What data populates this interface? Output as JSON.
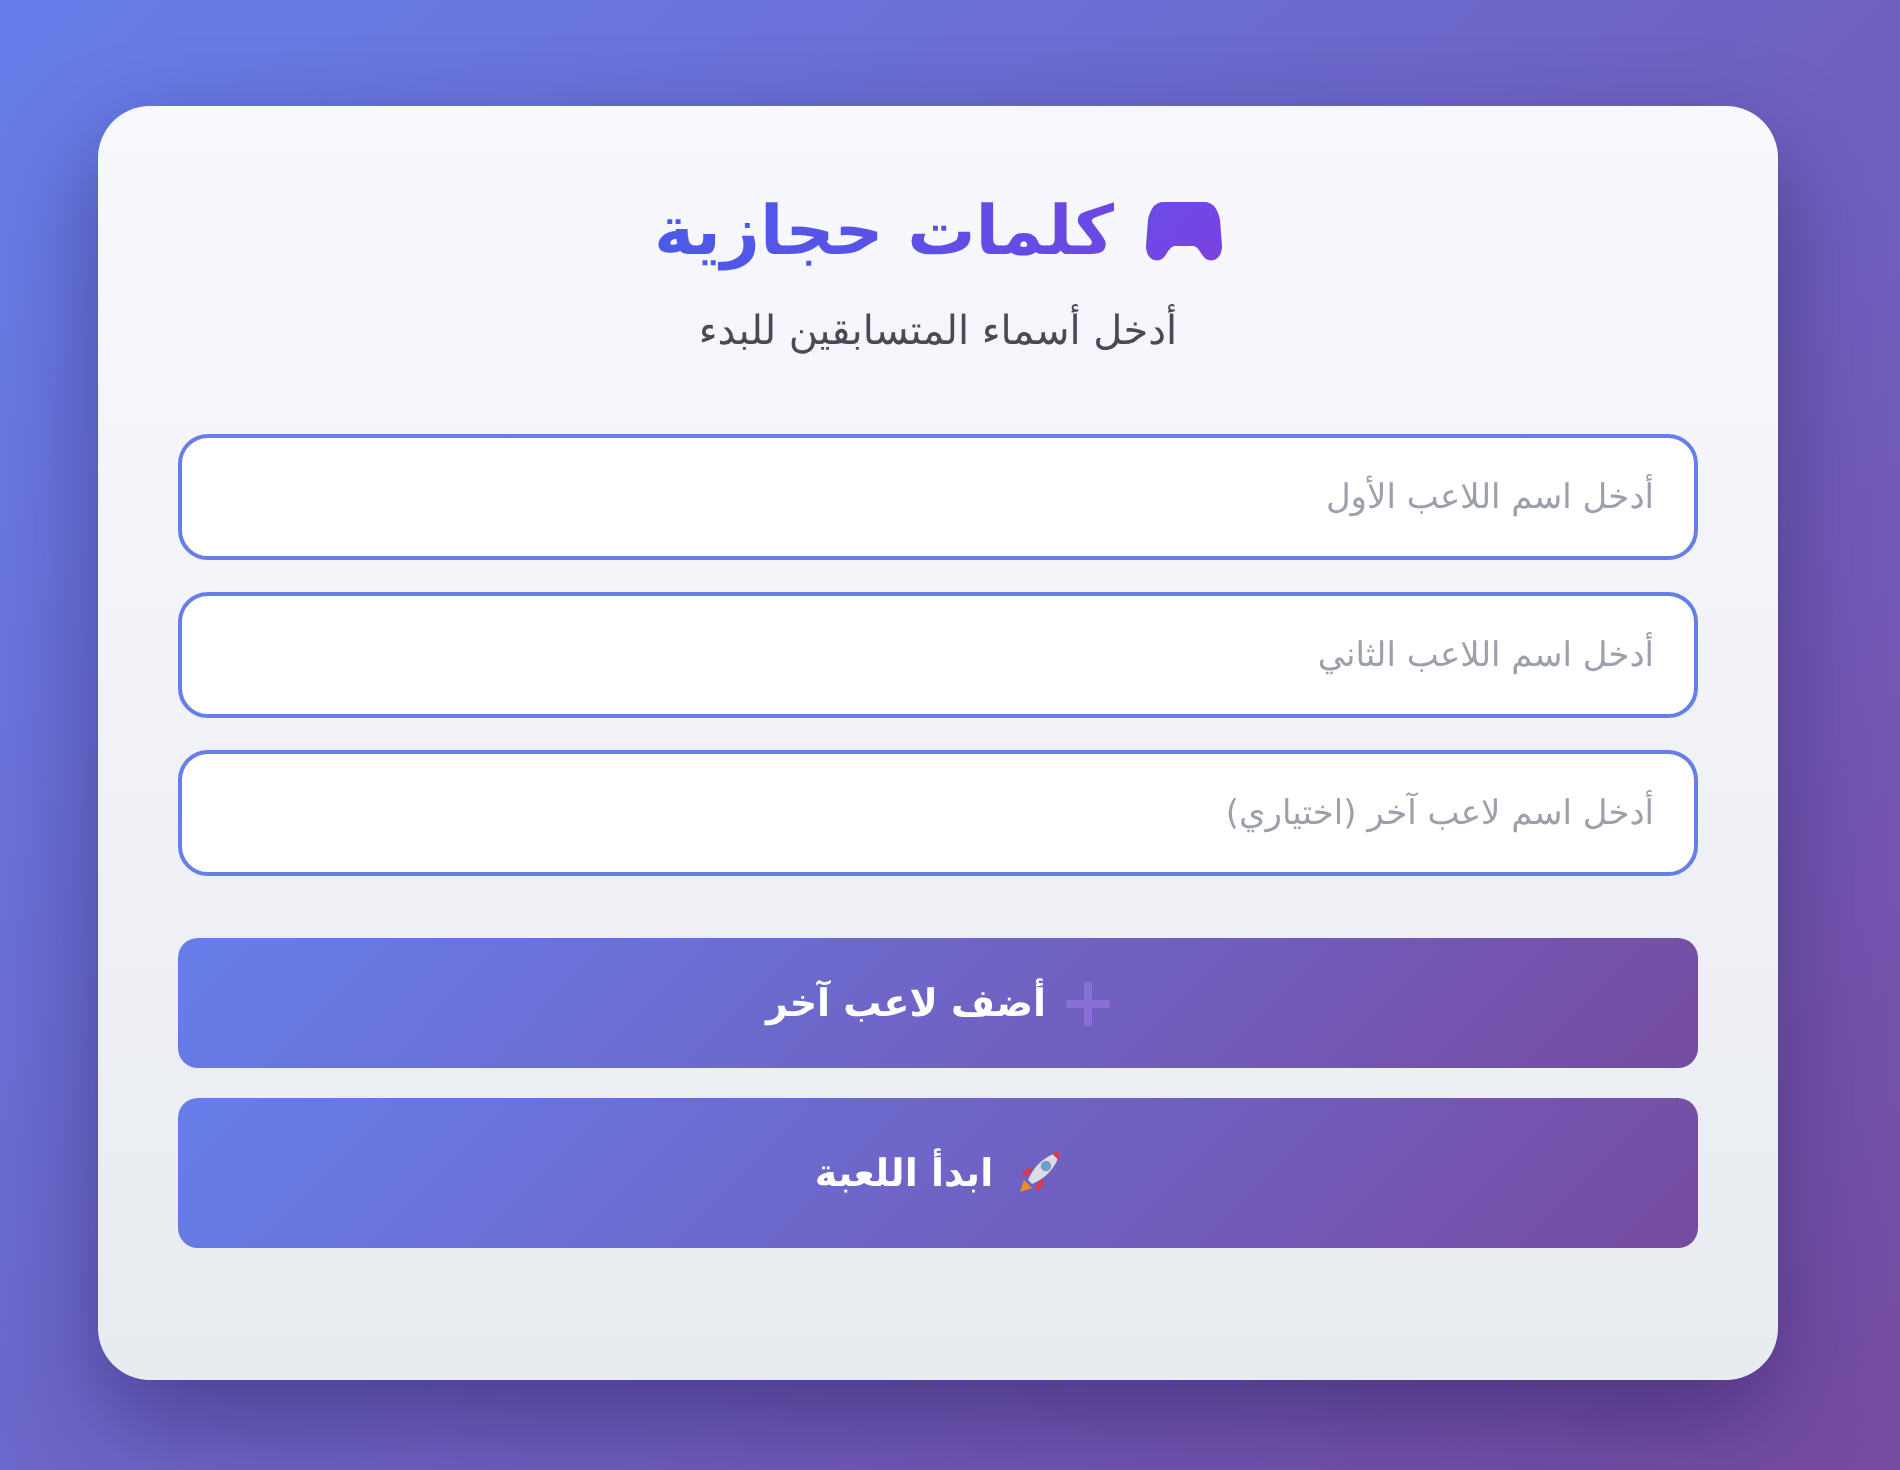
{
  "header": {
    "title": "كلمات حجازية",
    "subtitle": "أدخل أسماء المتسابقين للبدء"
  },
  "fields": [
    {
      "placeholder": "أدخل اسم اللاعب الأول"
    },
    {
      "placeholder": "أدخل اسم اللاعب الثاني"
    },
    {
      "placeholder": "أدخل اسم لاعب آخر (اختياري)"
    }
  ],
  "buttons": [
    {
      "kind": "add",
      "label": "أضف لاعب آخر"
    },
    {
      "kind": "start",
      "label": "ابدأ اللعبة"
    }
  ]
}
